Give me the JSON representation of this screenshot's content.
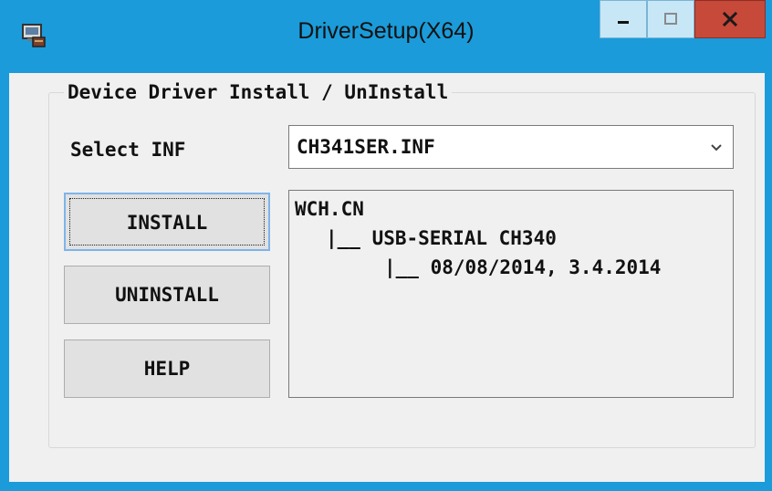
{
  "window": {
    "title": "DriverSetup(X64)",
    "icons": {
      "app": "driver-setup-icon",
      "minimize": "minimize-icon",
      "maximize": "maximize-icon",
      "close": "close-icon"
    }
  },
  "group": {
    "title": "Device Driver Install / UnInstall"
  },
  "select_inf": {
    "label": "Select INF",
    "value": "CH341SER.INF",
    "icon": "chevron-down-icon"
  },
  "buttons": {
    "install": "INSTALL",
    "uninstall": "UNINSTALL",
    "help": "HELP"
  },
  "info": {
    "lines": [
      "WCH.CN",
      "|__ USB-SERIAL CH340",
      "|__ 08/08/2014, 3.4.2014"
    ]
  },
  "colors": {
    "title_bar": "#1b9bd9",
    "close_button": "#c6493a",
    "client_background": "#f0f0f0"
  }
}
